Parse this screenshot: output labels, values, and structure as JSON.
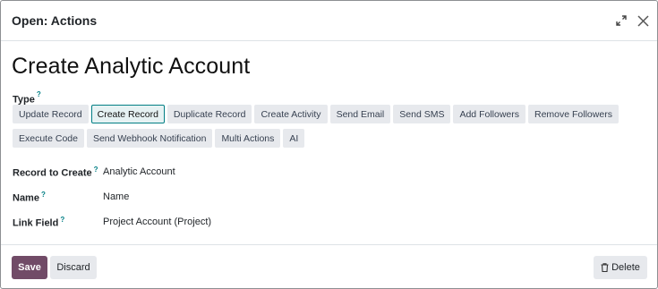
{
  "dialog": {
    "title": "Open: Actions"
  },
  "record": {
    "title": "Create Analytic Account"
  },
  "type_field": {
    "label": "Type",
    "help": "?",
    "options_row1": [
      "Update Record",
      "Create Record",
      "Duplicate Record",
      "Create Activity",
      "Send Email",
      "Send SMS",
      "Add Followers",
      "Remove Followers"
    ],
    "options_row2": [
      "Execute Code",
      "Send Webhook Notification",
      "Multi Actions",
      "AI"
    ],
    "selected": "Create Record"
  },
  "fields": {
    "record_to_create": {
      "label": "Record to Create",
      "help": "?",
      "value": "Analytic Account"
    },
    "name": {
      "label": "Name",
      "help": "?",
      "value": "Name"
    },
    "link_field": {
      "label": "Link Field",
      "help": "?",
      "value": "Project Account (Project)"
    }
  },
  "footer": {
    "save_label": "Save",
    "discard_label": "Discard",
    "delete_label": "Delete"
  },
  "icons": {
    "expand": "expand-icon",
    "close": "close-icon",
    "trash": "trash-icon"
  },
  "colors": {
    "primary": "#714b67",
    "accent": "#017e84",
    "secondary_button": "#e7e9ed"
  }
}
